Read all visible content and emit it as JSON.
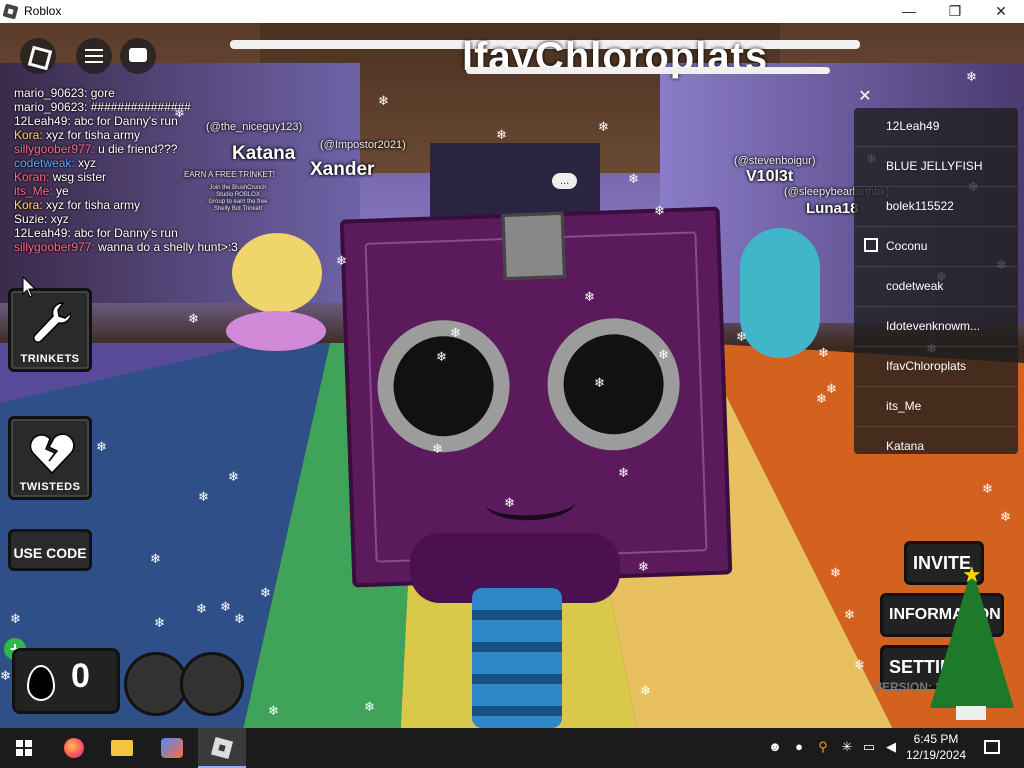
{
  "window": {
    "title": "Roblox",
    "minimize": "—",
    "maximize": "❐",
    "close": "✕"
  },
  "banner": {
    "title": "lfavChloroplats"
  },
  "chat": {
    "lines": [
      {
        "name": "mario_90623:",
        "text": "gore",
        "color": "white"
      },
      {
        "name": "mario_90623:",
        "text": "###############",
        "color": "white"
      },
      {
        "name": "12Leah49:",
        "text": "abc for Danny's run",
        "color": "white"
      },
      {
        "name": "Kora:",
        "text": "xyz for tisha army",
        "color": "yellow"
      },
      {
        "name": "sillygoober977:",
        "text": "u die friend???",
        "color": "pink"
      },
      {
        "name": "codetweak:",
        "text": "xyz",
        "color": "blue"
      },
      {
        "name": "Koran:",
        "text": "wsg sister",
        "color": "pink"
      },
      {
        "name": "its_Me:",
        "text": "ye",
        "color": "pink"
      },
      {
        "name": "Kora:",
        "text": "xyz for tisha army",
        "color": "yellow"
      },
      {
        "name": "Suzie:",
        "text": "xyz",
        "color": "white"
      },
      {
        "name": "12Leah49:",
        "text": "abc for Danny's run",
        "color": "white"
      },
      {
        "name": "sillygoober977:",
        "text": "wanna do a shelly hunt>:3",
        "color": "pink"
      }
    ]
  },
  "name_tags": {
    "niceguy": "(@the_niceguy123)",
    "katana": "Katana",
    "xander": "Xander",
    "impostor": "(@Impostor2021)",
    "stevenboigur": "(@stevenboigur)",
    "violet": "V10l3t",
    "sleepy": "(@sleepybearbethbk)",
    "luna": "Luna18",
    "bubble": "...",
    "poster": "EARN A FREE TRINKET!",
    "poster_sub": "Join the BlushCrunch Studio ROBLOX Group to earn the free Shelly Bot Trinket!"
  },
  "left_buttons": {
    "trinkets": "TRINKETS",
    "twisteds": "TWISTEDS",
    "use_code": "USE CODE"
  },
  "currency": {
    "value": "0",
    "plus": "+"
  },
  "player_list": {
    "close": "✕",
    "players": [
      "12Leah49",
      "BLUE JELLYFISH",
      "bolek115522",
      "Coconu",
      "codetweak",
      "Idotevenknowm...",
      "IfavChloroplats",
      "its_Me",
      "Katana"
    ]
  },
  "right_buttons": {
    "invite": "INVITE",
    "information": "INFORMATION",
    "settings": "SETTINGS"
  },
  "version": "VERSION: 2.0.0.2",
  "taskbar": {
    "time": "6:45 PM",
    "date": "12/19/2024"
  }
}
